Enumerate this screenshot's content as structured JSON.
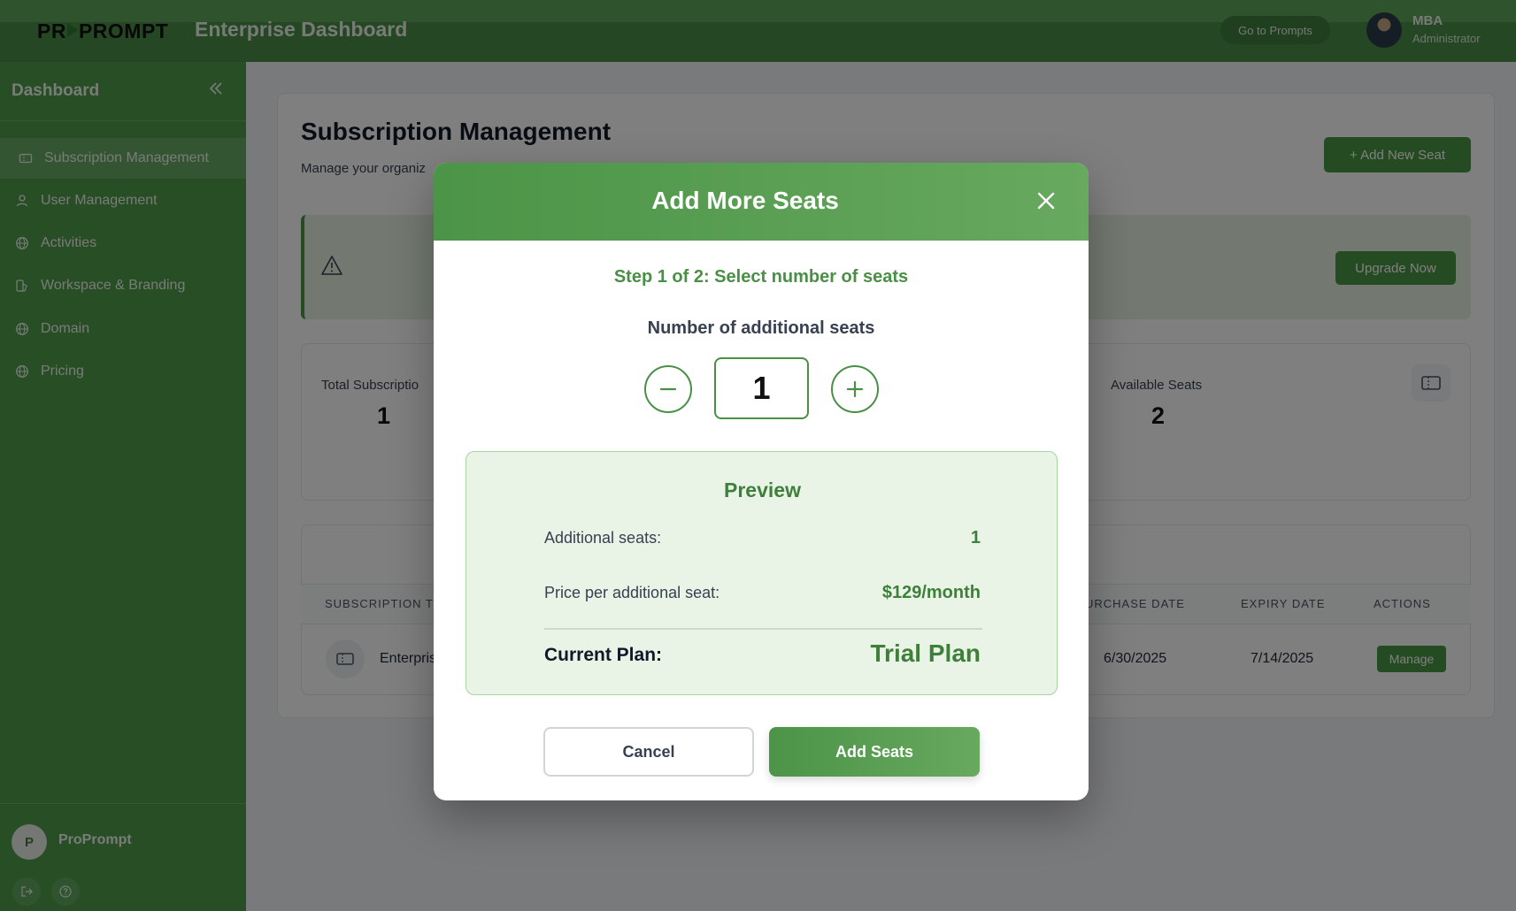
{
  "header": {
    "logo_left": "PR",
    "logo_right": "PROMPT",
    "app_title": "Enterprise Dashboard",
    "goto_prompts": "Go to Prompts",
    "user_name": "MBA",
    "user_role": "Administrator"
  },
  "sidebar": {
    "title": "Dashboard",
    "items": [
      {
        "label": "Subscription Management",
        "icon": "ticket-icon"
      },
      {
        "label": "User Management",
        "icon": "users-icon"
      },
      {
        "label": "Activities",
        "icon": "globe-icon"
      },
      {
        "label": "Workspace & Branding",
        "icon": "palette-icon"
      },
      {
        "label": "Domain",
        "icon": "globe-icon"
      },
      {
        "label": "Pricing",
        "icon": "globe-icon"
      }
    ],
    "footer_initial": "P",
    "footer_name": "ProPrompt"
  },
  "main": {
    "title": "Subscription Management",
    "subtitle": "Manage your organiz",
    "add_new_seat": "+ Add New Seat",
    "upgrade_now": "Upgrade Now",
    "stats": {
      "total_label": "Total Subscriptio",
      "total_value": "1",
      "available_label": "Available Seats",
      "available_value": "2"
    },
    "table": {
      "headers": [
        "SUBSCRIPTION TY",
        "URCHASE DATE",
        "EXPIRY DATE",
        "ACTIONS"
      ],
      "row": {
        "type": "Enterpris",
        "purchase_date": "6/30/2025",
        "expiry_date": "7/14/2025",
        "action": "Manage"
      }
    }
  },
  "modal": {
    "title": "Add More Seats",
    "step": "Step 1 of 2: Select number of seats",
    "seats_label": "Number of additional seats",
    "seat_count": "1",
    "preview": {
      "title": "Preview",
      "additional_label": "Additional seats:",
      "additional_value": "1",
      "price_label": "Price per additional seat:",
      "price_value": "$129/month",
      "plan_label": "Current Plan:",
      "plan_value": "Trial Plan"
    },
    "cancel": "Cancel",
    "add_seats": "Add Seats"
  },
  "colors": {
    "primary": "#4a9646",
    "header": "#4a8f46",
    "preview_bg": "#e9f4e7"
  }
}
